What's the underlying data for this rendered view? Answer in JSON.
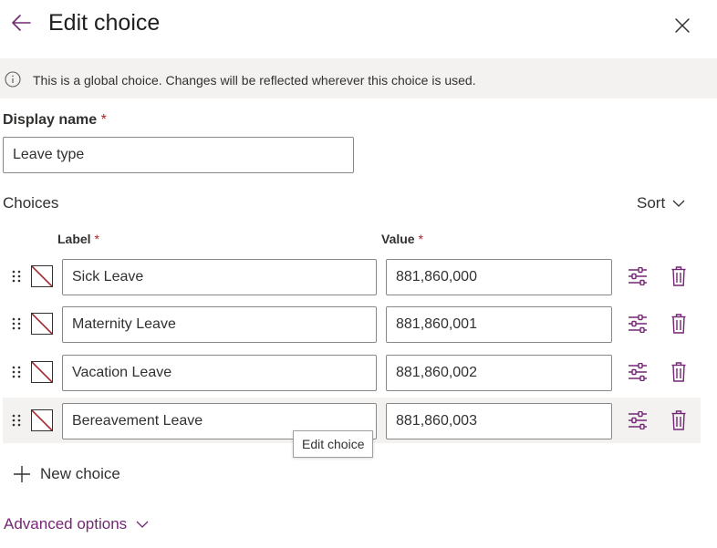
{
  "header": {
    "title": "Edit choice"
  },
  "banner": {
    "text": "This is a global choice. Changes will be reflected wherever this choice is used."
  },
  "display_name": {
    "label": "Display name",
    "required_mark": "*",
    "value": "Leave type"
  },
  "choices": {
    "heading": "Choices",
    "sort_label": "Sort",
    "label_header": "Label",
    "value_header": "Value",
    "required_mark": "*",
    "rows": [
      {
        "label": "Sick Leave",
        "value": "881,860,000"
      },
      {
        "label": "Maternity Leave",
        "value": "881,860,001"
      },
      {
        "label": "Vacation Leave",
        "value": "881,860,002"
      },
      {
        "label": "Bereavement Leave",
        "value": "881,860,003"
      }
    ],
    "tooltip": "Edit choice",
    "new_choice_label": "New choice"
  },
  "advanced_options": {
    "label": "Advanced options"
  },
  "colors": {
    "accent": "#742774",
    "required": "#a4262c",
    "banner_bg": "#f3f2f1",
    "swatch_slash": "#a4262c"
  },
  "icons": {
    "back": "back-arrow-icon",
    "close": "close-icon",
    "info": "info-icon",
    "sort": "chevron-down-icon",
    "drag": "drag-handle-icon",
    "edit": "sliders-icon",
    "delete": "trash-icon",
    "add": "plus-icon",
    "advanced": "chevron-down-icon"
  }
}
